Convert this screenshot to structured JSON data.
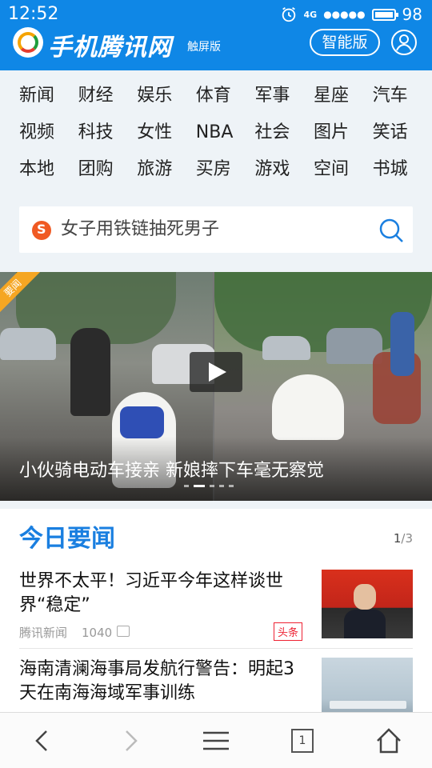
{
  "status_bar": {
    "time": "12:52",
    "network": "4G",
    "signal": "●●●●●",
    "battery": "98"
  },
  "header": {
    "logo_text": "手机腾讯网",
    "logo_sub": "触屏版",
    "smart_button": "智能版",
    "icons": {
      "user": "user-icon",
      "brand": "tencent-logo-icon"
    },
    "color": "#0f87e6"
  },
  "categories": [
    "新闻",
    "财经",
    "娱乐",
    "体育",
    "军事",
    "星座",
    "汽车",
    "视频",
    "科技",
    "女性",
    "NBA",
    "社会",
    "图片",
    "笑话",
    "本地",
    "团购",
    "旅游",
    "买房",
    "游戏",
    "空间",
    "书城"
  ],
  "search": {
    "text": "女子用铁链抽死男子",
    "icons": {
      "left": "sogou-icon",
      "right": "search-icon"
    }
  },
  "hero": {
    "badge": "要闻",
    "caption": "小伙骑电动车接亲 新娘摔下车毫无察觉",
    "dots_count": 5,
    "active_dot": 1,
    "icons": {
      "play": "play-icon"
    }
  },
  "news": {
    "title": "今日要闻",
    "page_current": "1",
    "page_total": "/3",
    "items": [
      {
        "headline": "世界不太平！习近平今年这样谈世界“稳定”",
        "source": "腾讯新闻",
        "comments": "1040",
        "tag": "头条"
      },
      {
        "headline": "海南清澜海事局发航行警告：明起3天在南海海域军事训练"
      }
    ],
    "accent": "#1a7fe0"
  },
  "bottom_nav": {
    "tab_count": "1",
    "icons": [
      "back-icon",
      "forward-icon",
      "menu-icon",
      "tabs-icon",
      "home-icon"
    ]
  }
}
